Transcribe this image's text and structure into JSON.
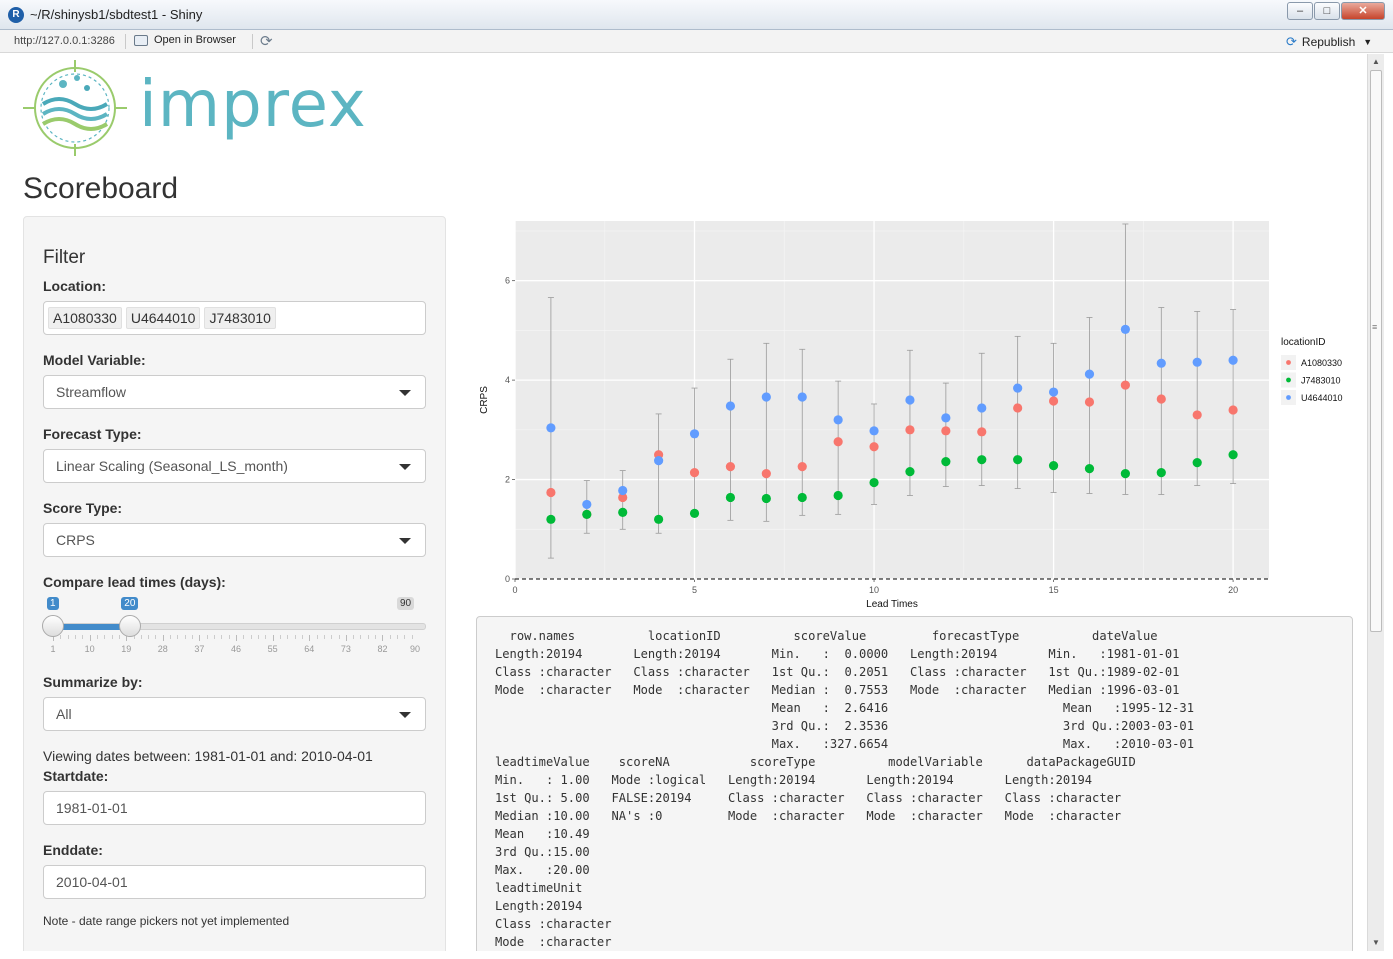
{
  "window": {
    "title": "~/R/shinysb1/sbdtest1 - Shiny",
    "url": "http://127.0.0.1:3286",
    "open_in_browser": "Open in Browser",
    "republish": "Republish"
  },
  "header": {
    "logo_text": "imprex",
    "page_title": "Scoreboard"
  },
  "sidebar": {
    "filter_title": "Filter",
    "location_label": "Location:",
    "locations": [
      "A1080330",
      "U4644010",
      "J7483010"
    ],
    "model_variable_label": "Model Variable:",
    "model_variable_value": "Streamflow",
    "forecast_type_label": "Forecast Type:",
    "forecast_type_value": "Linear Scaling (Seasonal_LS_month)",
    "score_type_label": "Score Type:",
    "score_type_value": "CRPS",
    "compare_label": "Compare lead times (days):",
    "slider": {
      "from": "1",
      "to": "20",
      "max": "90",
      "min_value": 1,
      "max_value": 90,
      "tick_labels": [
        "1",
        "10",
        "19",
        "28",
        "37",
        "46",
        "55",
        "64",
        "73",
        "82",
        "90"
      ]
    },
    "summarize_label": "Summarize by:",
    "summarize_value": "All",
    "viewing_text": "Viewing dates between: 1981-01-01 and: 2010-04-01",
    "startdate_label": "Startdate:",
    "startdate_value": "1981-01-01",
    "enddate_label": "Enddate:",
    "enddate_value": "2010-04-01",
    "note": "Note - date range pickers not yet implemented"
  },
  "chart_data": {
    "type": "scatter",
    "title": "",
    "xlabel": "Lead Times",
    "ylabel": "CRPS",
    "xlim": [
      0,
      21
    ],
    "ylim": [
      0,
      7.2
    ],
    "xticks": [
      0,
      5,
      10,
      15,
      20
    ],
    "yticks": [
      0,
      2,
      4,
      6
    ],
    "grid": true,
    "reference_line": {
      "y": 0,
      "style": "dashed"
    },
    "legend": {
      "title": "locationID",
      "position": "right"
    },
    "series": [
      {
        "name": "A1080330",
        "color": "#F8766D",
        "x": [
          1,
          2,
          3,
          4,
          5,
          6,
          7,
          8,
          9,
          10,
          11,
          12,
          13,
          14,
          15,
          16,
          17,
          18,
          19,
          20
        ],
        "y": [
          1.74,
          1.3,
          1.64,
          2.5,
          2.14,
          2.26,
          2.12,
          2.26,
          2.76,
          2.66,
          3.0,
          2.98,
          2.96,
          3.44,
          3.58,
          3.56,
          3.9,
          3.62,
          3.3,
          3.4
        ]
      },
      {
        "name": "J7483010",
        "color": "#00BA38",
        "x": [
          1,
          2,
          3,
          4,
          5,
          6,
          7,
          8,
          9,
          10,
          11,
          12,
          13,
          14,
          15,
          16,
          17,
          18,
          19,
          20
        ],
        "y": [
          1.2,
          1.3,
          1.34,
          1.2,
          1.32,
          1.64,
          1.62,
          1.64,
          1.68,
          1.94,
          2.16,
          2.36,
          2.4,
          2.4,
          2.28,
          2.22,
          2.12,
          2.14,
          2.34,
          2.5
        ]
      },
      {
        "name": "U4644010",
        "color": "#619CFF",
        "x": [
          1,
          2,
          3,
          4,
          5,
          6,
          7,
          8,
          9,
          10,
          11,
          12,
          13,
          14,
          15,
          16,
          17,
          18,
          19,
          20
        ],
        "y": [
          3.04,
          1.5,
          1.78,
          2.38,
          2.92,
          3.48,
          3.66,
          3.66,
          3.2,
          2.98,
          3.6,
          3.24,
          3.44,
          3.84,
          3.76,
          4.12,
          5.02,
          4.34,
          4.36,
          4.4
        ]
      }
    ],
    "error_bars": [
      {
        "x": 1,
        "lo": 0.42,
        "hi": 5.66
      },
      {
        "x": 2,
        "lo": 0.92,
        "hi": 1.98
      },
      {
        "x": 3,
        "lo": 1.0,
        "hi": 2.18
      },
      {
        "x": 4,
        "lo": 0.92,
        "hi": 3.32
      },
      {
        "x": 5,
        "lo": 1.28,
        "hi": 3.84
      },
      {
        "x": 6,
        "lo": 1.18,
        "hi": 4.42
      },
      {
        "x": 7,
        "lo": 1.16,
        "hi": 4.74
      },
      {
        "x": 8,
        "lo": 1.28,
        "hi": 4.62
      },
      {
        "x": 9,
        "lo": 1.3,
        "hi": 3.98
      },
      {
        "x": 10,
        "lo": 1.5,
        "hi": 3.52
      },
      {
        "x": 11,
        "lo": 1.68,
        "hi": 4.6
      },
      {
        "x": 12,
        "lo": 1.86,
        "hi": 3.94
      },
      {
        "x": 13,
        "lo": 1.88,
        "hi": 4.54
      },
      {
        "x": 14,
        "lo": 1.82,
        "hi": 4.88
      },
      {
        "x": 15,
        "lo": 1.74,
        "hi": 4.74
      },
      {
        "x": 16,
        "lo": 1.72,
        "hi": 5.26
      },
      {
        "x": 17,
        "lo": 1.7,
        "hi": 7.14
      },
      {
        "x": 18,
        "lo": 1.7,
        "hi": 5.46
      },
      {
        "x": 19,
        "lo": 1.88,
        "hi": 5.38
      },
      {
        "x": 20,
        "lo": 1.92,
        "hi": 5.42
      }
    ]
  },
  "summary_lines": [
    "  row.names          locationID          scoreValue         forecastType          dateValue",
    "Length:20194       Length:20194       Min.   :  0.0000   Length:20194       Min.   :1981-01-01",
    "Class :character   Class :character   1st Qu.:  0.2051   Class :character   1st Qu.:1989-02-01",
    "Mode  :character   Mode  :character   Median :  0.7553   Mode  :character   Median :1996-03-01",
    "                                      Mean   :  2.6416                        Mean   :1995-12-31",
    "                                      3rd Qu.:  2.3536                        3rd Qu.:2003-03-01",
    "                                      Max.   :327.6654                        Max.   :2010-03-01",
    "leadtimeValue    scoreNA           scoreType          modelVariable      dataPackageGUID",
    "Min.   : 1.00   Mode :logical   Length:20194       Length:20194       Length:20194",
    "1st Qu.: 5.00   FALSE:20194     Class :character   Class :character   Class :character",
    "Median :10.00   NA's :0         Mode  :character   Mode  :character   Mode  :character",
    "Mean   :10.49",
    "3rd Qu.:15.00",
    "Max.   :20.00",
    "leadtimeUnit",
    "Length:20194",
    "Class :character",
    "Mode  :character"
  ]
}
